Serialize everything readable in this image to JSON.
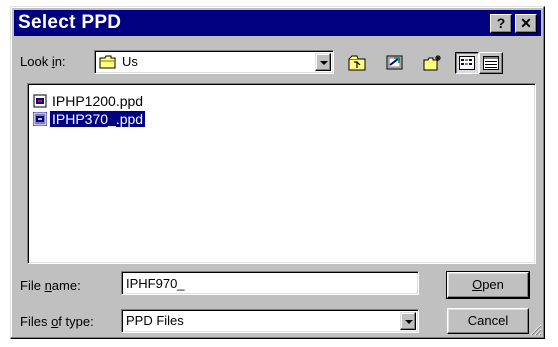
{
  "window": {
    "title": "Select PPD",
    "help_label": "?",
    "close_label": "✕"
  },
  "lookin": {
    "label_prefix": "Look ",
    "label_key": "i",
    "label_suffix": "n:",
    "value": "Us",
    "icon": "folder-icon"
  },
  "toolbar": {
    "icons": [
      "up-one-level-icon",
      "desktop-icon",
      "new-folder-icon",
      "list-view-icon",
      "details-view-icon"
    ]
  },
  "files": [
    {
      "name": "IPHP1200.ppd",
      "icon": "ppd-file-icon",
      "selected": false
    },
    {
      "name": "IPHP370_.ppd",
      "icon": "ppd-file-icon",
      "selected": true
    }
  ],
  "filename": {
    "label_prefix": "File ",
    "label_key": "n",
    "label_suffix": "ame:",
    "value": "IPHF970_"
  },
  "filetype": {
    "label_prefix": "Files ",
    "label_key": "o",
    "label_suffix": "f type:",
    "value": "PPD Files"
  },
  "buttons": {
    "open_key": "O",
    "open_rest": "pen",
    "cancel": "Cancel"
  },
  "colors": {
    "titlebar": "#000080",
    "face": "#c0c0c0",
    "selection": "#000080"
  }
}
